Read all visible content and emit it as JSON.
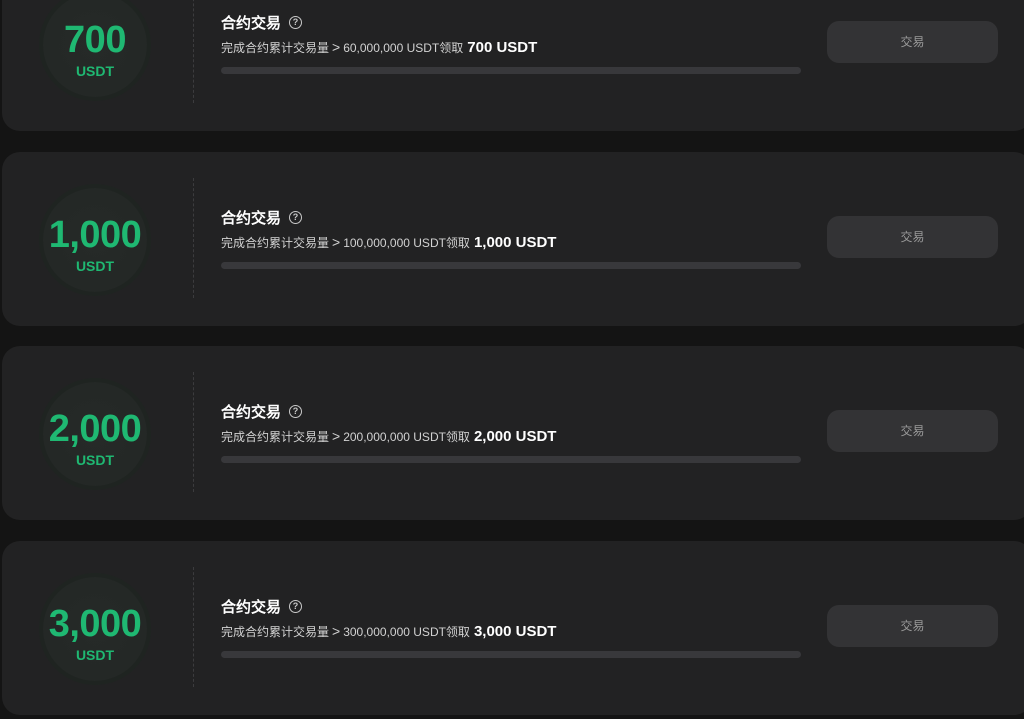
{
  "tasks": [
    {
      "amount": "700",
      "unit": "USDT",
      "title": "合约交易",
      "help_icon": "question-circle-icon",
      "desc_prefix": "完成合约累计交易量",
      "gt": ">",
      "desc_threshold": "60,000,000 USDT领取",
      "desc_reward": "700 USDT",
      "progress": 0,
      "button_label": "交易"
    },
    {
      "amount": "1,000",
      "unit": "USDT",
      "title": "合约交易",
      "help_icon": "question-circle-icon",
      "desc_prefix": "完成合约累计交易量",
      "gt": ">",
      "desc_threshold": "100,000,000 USDT领取",
      "desc_reward": "1,000 USDT",
      "progress": 0,
      "button_label": "交易"
    },
    {
      "amount": "2,000",
      "unit": "USDT",
      "title": "合约交易",
      "help_icon": "question-circle-icon",
      "desc_prefix": "完成合约累计交易量",
      "gt": ">",
      "desc_threshold": "200,000,000 USDT领取",
      "desc_reward": "2,000 USDT",
      "progress": 0,
      "button_label": "交易"
    },
    {
      "amount": "3,000",
      "unit": "USDT",
      "title": "合约交易",
      "help_icon": "question-circle-icon",
      "desc_prefix": "完成合约累计交易量",
      "gt": ">",
      "desc_threshold": "300,000,000 USDT领取",
      "desc_reward": "3,000 USDT",
      "progress": 0,
      "button_label": "交易"
    }
  ],
  "colors": {
    "accent": "#1fb872",
    "card_bg": "#222223",
    "page_bg": "#141414",
    "button_bg": "#333335"
  }
}
